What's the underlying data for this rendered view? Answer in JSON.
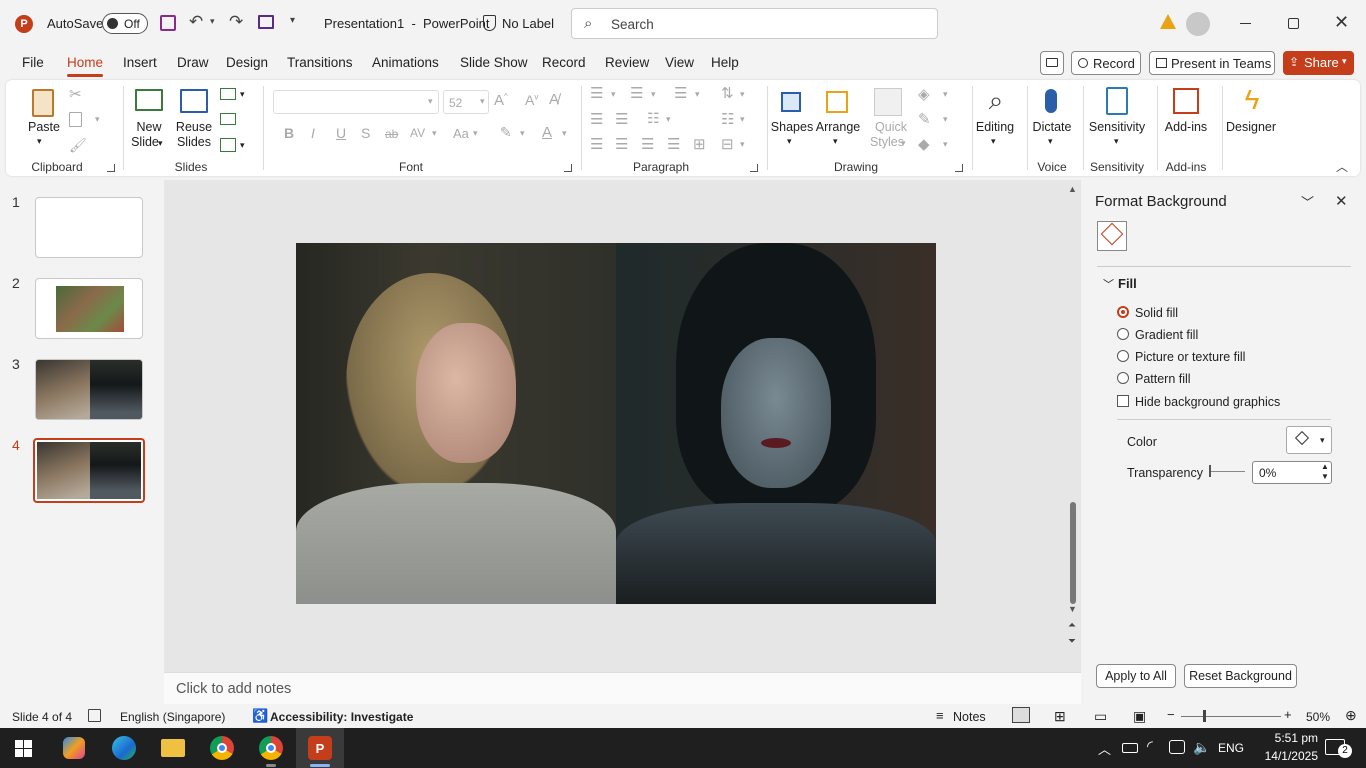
{
  "titlebar": {
    "autosave_label": "AutoSave",
    "autosave_state": "Off",
    "doc_title": "Presentation1  -  PowerPoint",
    "label_status": "No Label",
    "search_placeholder": "Search"
  },
  "tabs": [
    "File",
    "Home",
    "Insert",
    "Draw",
    "Design",
    "Transitions",
    "Animations",
    "Slide Show",
    "Record",
    "Review",
    "View",
    "Help"
  ],
  "tab_actions": {
    "record": "Record",
    "present": "Present in Teams",
    "share": "Share"
  },
  "ribbon": {
    "clipboard": {
      "paste": "Paste",
      "label": "Clipboard"
    },
    "slides": {
      "new_slide_1": "New",
      "new_slide_2": "Slide",
      "reuse_1": "Reuse",
      "reuse_2": "Slides",
      "label": "Slides"
    },
    "font": {
      "size": "52",
      "label": "Font",
      "bold": "B",
      "italic": "I",
      "underline": "U",
      "shadow": "S",
      "strike": "ab",
      "spacing": "AV",
      "case": "Aa",
      "color": "A"
    },
    "paragraph": {
      "label": "Paragraph"
    },
    "drawing": {
      "shapes": "Shapes",
      "arrange": "Arrange",
      "quick_1": "Quick",
      "quick_2": "Styles",
      "label": "Drawing"
    },
    "editing": {
      "label_btn": "Editing"
    },
    "voice": {
      "dictate": "Dictate",
      "label": "Voice"
    },
    "sensitivity": {
      "btn": "Sensitivity",
      "label": "Sensitivity"
    },
    "addins": {
      "btn": "Add-ins",
      "label": "Add-ins"
    },
    "designer": {
      "btn": "Designer"
    }
  },
  "slides_pane": {
    "numbers": [
      "1",
      "2",
      "3",
      "4"
    ],
    "selected": "4"
  },
  "notes_placeholder": "Click to add notes",
  "format_panel": {
    "title": "Format Background",
    "section": "Fill",
    "options": [
      "Solid fill",
      "Gradient fill",
      "Picture or texture fill",
      "Pattern fill"
    ],
    "selected": "Solid fill",
    "hide_graphics": "Hide background graphics",
    "color_label": "Color",
    "transparency_label": "Transparency",
    "transparency_value": "0%",
    "apply_all": "Apply to All",
    "reset": "Reset Background"
  },
  "status": {
    "slide": "Slide 4 of 4",
    "language": "English (Singapore)",
    "accessibility": "Accessibility: Investigate",
    "notes": "Notes",
    "zoom": "50%"
  },
  "taskbar": {
    "lang": "ENG",
    "time": "5:51 pm",
    "date": "14/1/2025",
    "notif_count": "2"
  },
  "colors": {
    "accent": "#c43e1c",
    "taskbar": "#1f1f1f"
  }
}
